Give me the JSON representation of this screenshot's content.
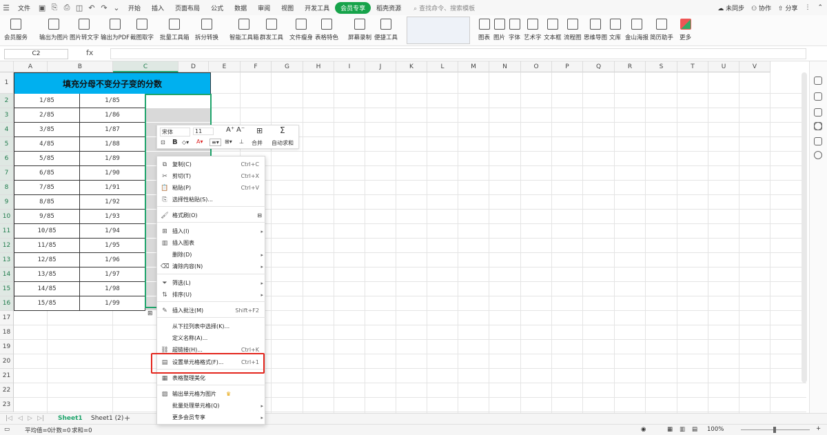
{
  "menubar": {
    "file": "文件",
    "tabs": [
      "开始",
      "插入",
      "页面布局",
      "公式",
      "数据",
      "审阅",
      "视图",
      "开发工具",
      "会员专享",
      "稻壳资源"
    ],
    "active_tab": "会员专享",
    "search_placeholder": "查找命令、搜索模板",
    "right": {
      "sync": "未同步",
      "collab": "协作",
      "share": "分享"
    }
  },
  "ribbon": {
    "items": [
      "会员服务",
      "输出为图片",
      "图片转文字",
      "输出为PDF",
      "截图取字",
      "批量工具箱",
      "拆分转换",
      "智能工具箱",
      "群发工具",
      "文件瘦身",
      "表格特色",
      "屏幕录制",
      "便捷工具"
    ],
    "right_items": [
      "图表",
      "图片",
      "字体",
      "艺术字",
      "文本框",
      "流程图",
      "思维导图",
      "文库",
      "金山海报",
      "简历助手",
      "更多"
    ]
  },
  "formula": {
    "namebox": "C2",
    "fx": "fx"
  },
  "columns": [
    "A",
    "B",
    "C",
    "D",
    "E",
    "F",
    "G",
    "H",
    "I",
    "J",
    "K",
    "L",
    "M",
    "N",
    "O",
    "P",
    "Q",
    "R",
    "S",
    "T",
    "U",
    "V"
  ],
  "rows": [
    "1",
    "2",
    "3",
    "4",
    "5",
    "6",
    "7",
    "8",
    "9",
    "10",
    "11",
    "12",
    "13",
    "14",
    "15",
    "16",
    "17",
    "18",
    "19",
    "20",
    "21",
    "22",
    "23"
  ],
  "sheet": {
    "title": "填充分母不变分子变的分数",
    "colA": [
      "1/85",
      "2/85",
      "3/85",
      "4/85",
      "5/85",
      "6/85",
      "7/85",
      "8/85",
      "9/85",
      "10/85",
      "11/85",
      "12/85",
      "13/85",
      "14/85",
      "15/85"
    ],
    "colB": [
      "1/85",
      "1/86",
      "1/87",
      "1/88",
      "1/89",
      "1/90",
      "1/91",
      "1/92",
      "1/93",
      "1/94",
      "1/95",
      "1/96",
      "1/97",
      "1/98",
      "1/99"
    ]
  },
  "minitoolbar": {
    "font": "宋体",
    "size": "11",
    "merge": "合并",
    "autosum": "自动求和"
  },
  "context_menu": [
    {
      "label": "复制(C)",
      "shortcut": "Ctrl+C",
      "icon": "copy-icon"
    },
    {
      "label": "剪切(T)",
      "shortcut": "Ctrl+X",
      "icon": "cut-icon"
    },
    {
      "label": "粘贴(P)",
      "shortcut": "Ctrl+V",
      "icon": "paste-icon"
    },
    {
      "label": "选择性粘贴(S)...",
      "shortcut": "",
      "icon": "paste-special-icon"
    },
    {
      "label": "格式刷(O)",
      "shortcut": "",
      "icon": "format-brush-icon"
    },
    {
      "label": "插入(I)",
      "shortcut": "",
      "icon": "insert-icon",
      "sub": true
    },
    {
      "label": "插入图表",
      "shortcut": "",
      "icon": "chart-icon"
    },
    {
      "label": "删除(D)",
      "shortcut": "",
      "icon": "",
      "sub": true
    },
    {
      "label": "清除内容(N)",
      "shortcut": "",
      "icon": "eraser-icon",
      "sub": true
    },
    {
      "label": "筛选(L)",
      "shortcut": "",
      "icon": "filter-icon",
      "sub": true
    },
    {
      "label": "排序(U)",
      "shortcut": "",
      "icon": "sort-icon",
      "sub": true
    },
    {
      "label": "插入批注(M)",
      "shortcut": "Shift+F2",
      "icon": "comment-icon"
    },
    {
      "label": "从下拉列表中选择(K)...",
      "shortcut": "",
      "icon": ""
    },
    {
      "label": "定义名称(A)...",
      "shortcut": "",
      "icon": ""
    },
    {
      "label": "超链接(H)...",
      "shortcut": "Ctrl+K",
      "icon": "link-icon"
    },
    {
      "label": "设置单元格格式(F)...",
      "shortcut": "Ctrl+1",
      "icon": "cell-format-icon"
    },
    {
      "label": "表格整理美化",
      "shortcut": "",
      "icon": "table-beautify-icon"
    },
    {
      "label": "输出单元格为图片",
      "shortcut": "",
      "icon": "export-image-icon"
    },
    {
      "label": "批量处理单元格(Q)",
      "shortcut": "",
      "icon": "",
      "sub": true
    },
    {
      "label": "更多会员专享",
      "shortcut": "",
      "icon": "",
      "sub": true
    }
  ],
  "sheets": {
    "tabs": [
      "Sheet1",
      "Sheet1 (2)"
    ],
    "active": "Sheet1"
  },
  "status": {
    "avg": "平均值=0",
    "count": "计数=0",
    "sum": "求和=0",
    "zoom": "100%"
  },
  "colors": {
    "accent": "#1ea46b",
    "title_bg": "#00b0ef",
    "highlight": "#e3241b"
  }
}
